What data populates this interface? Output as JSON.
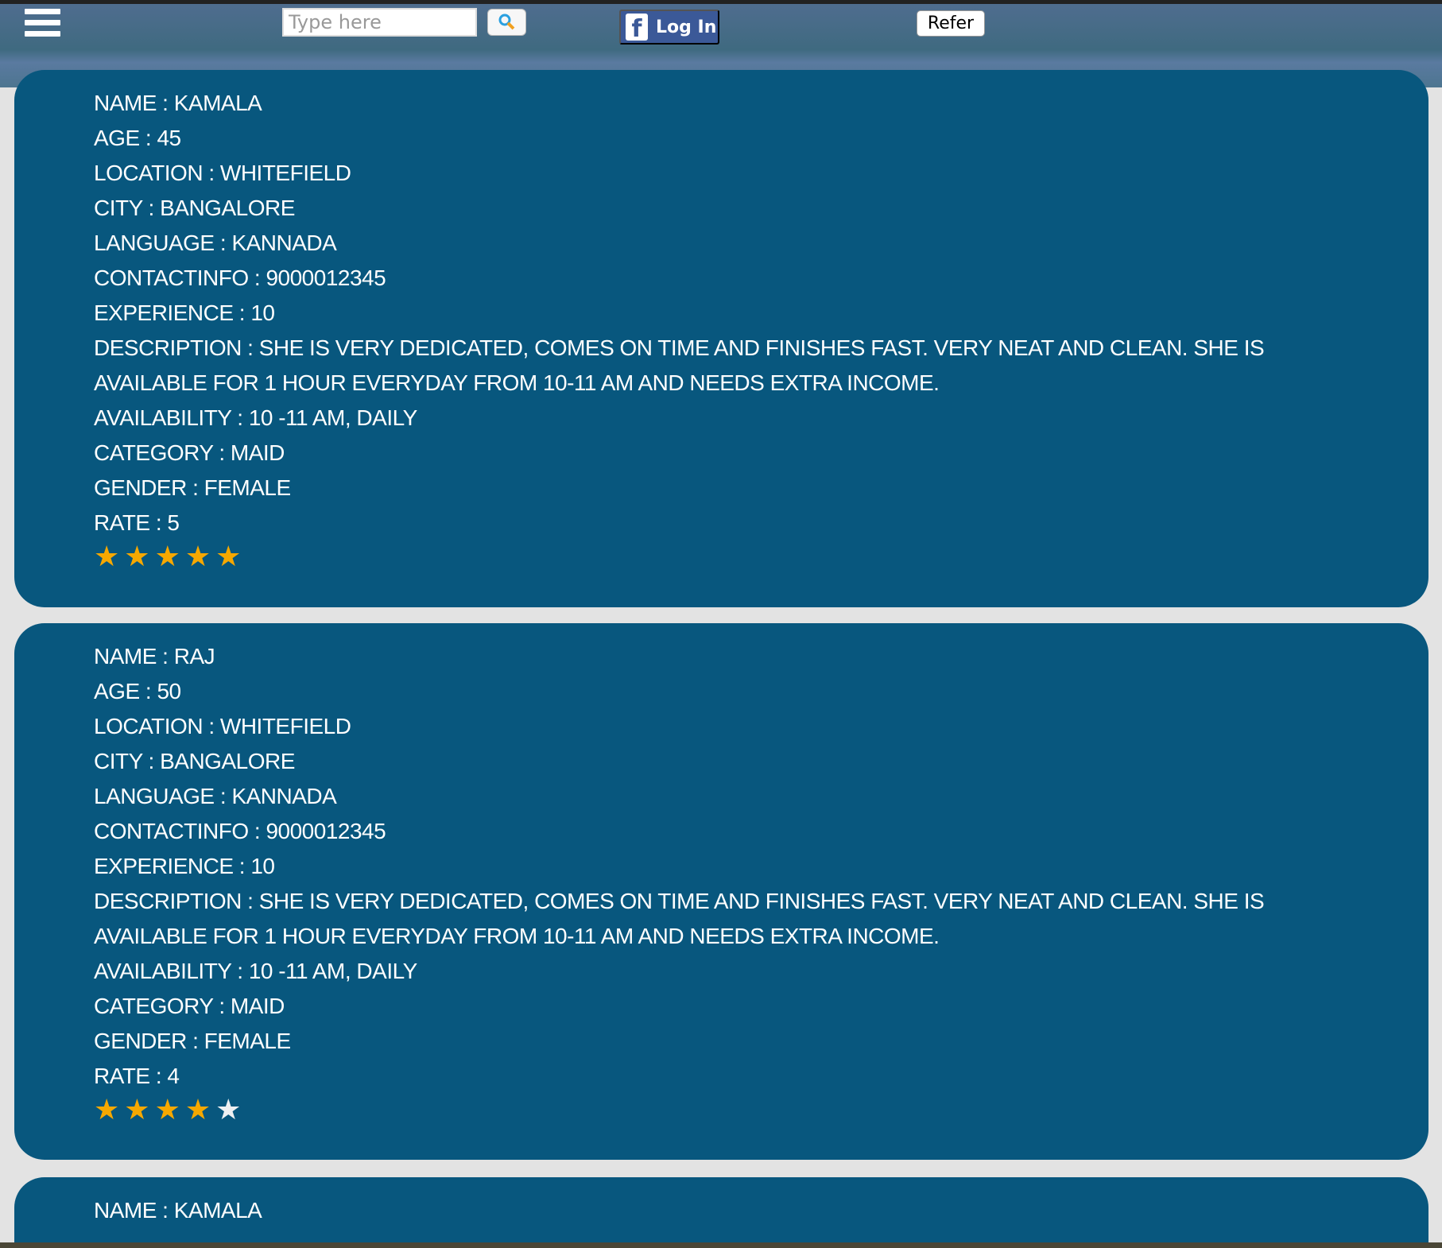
{
  "header": {
    "search_placeholder": "Type here",
    "login_label": "Log In",
    "refer_label": "Refer"
  },
  "colors": {
    "card": "#08577e",
    "star_on": "#f6a800",
    "star_off": "#eef0f2"
  },
  "cards": [
    {
      "lines": [
        "NAME : KAMALA",
        "AGE : 45",
        "LOCATION : WHITEFIELD",
        "CITY : BANGALORE",
        "LANGUAGE : KANNADA",
        "CONTACTINFO : 9000012345",
        "EXPERIENCE : 10",
        "DESCRIPTION : SHE IS VERY DEDICATED, COMES ON TIME AND FINISHES FAST. VERY NEAT AND CLEAN. SHE IS AVAILABLE FOR 1 HOUR EVERYDAY FROM 10-11 AM AND NEEDS EXTRA INCOME.",
        "AVAILABILITY : 10 -11 AM, DAILY",
        "CATEGORY : MAID",
        "GENDER : FEMALE",
        "RATE : 5"
      ],
      "rating": 5
    },
    {
      "lines": [
        "NAME : RAJ",
        "AGE : 50",
        "LOCATION : WHITEFIELD",
        "CITY : BANGALORE",
        "LANGUAGE : KANNADA",
        "CONTACTINFO : 9000012345",
        "EXPERIENCE : 10",
        "DESCRIPTION : SHE IS VERY DEDICATED, COMES ON TIME AND FINISHES FAST. VERY NEAT AND CLEAN. SHE IS AVAILABLE FOR 1 HOUR EVERYDAY FROM 10-11 AM AND NEEDS EXTRA INCOME.",
        "AVAILABILITY : 10 -11 AM, DAILY",
        "CATEGORY : MAID",
        "GENDER : FEMALE",
        "RATE : 4"
      ],
      "rating": 4
    },
    {
      "lines": [
        "NAME : KAMALA"
      ]
    }
  ]
}
